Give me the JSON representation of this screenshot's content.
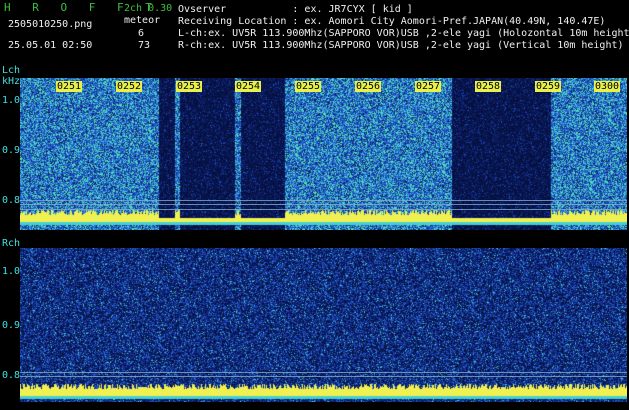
{
  "header": {
    "title": "H R O F F T",
    "mode": "2ch 0.30",
    "meteor_label": "meteor",
    "filename": "2505010250.png",
    "datetime": "25.05.01 02:50",
    "lch_count": "6",
    "rch_count": "73"
  },
  "info": {
    "observer": "Ovserver           : ex. JR7CYX [ kid ]",
    "location": "Receiving Location : ex. Aomori City Aomori-Pref.JAPAN(40.49N, 140.47E)",
    "lch": "L-ch:ex. UV5R 113.900Mhz(SAPPORO VOR)USB ,2-ele yagi (Holozontal 10m height)",
    "rch": "R-ch:ex. UV5R 113.900Mhz(SAPPORO VOR)USB ,2-ele yagi (Vertical 10m height)"
  },
  "lch": {
    "label": "Lch",
    "unit": "kHz",
    "yticks": [
      "1.0",
      "0.9",
      "0.8"
    ]
  },
  "rch": {
    "label": "Rch",
    "yticks": [
      "1.0",
      "0.9",
      "0.8"
    ]
  },
  "time_labels": [
    "0251",
    "0252",
    "0253",
    "0254",
    "0255",
    "0256",
    "0257",
    "0258",
    "0259",
    "0300"
  ],
  "colors": {
    "background": "#000000",
    "text_green": "#3fbf3f",
    "text_white": "#f0f0f0",
    "text_cyan": "#40e0e0",
    "noise_dark": "#0a1a5a",
    "noise_mid": "#1f50c8",
    "noise_bright": "#48d0d0",
    "baseline": "#f0f050",
    "tick_label_bg": "#eaf04a"
  }
}
